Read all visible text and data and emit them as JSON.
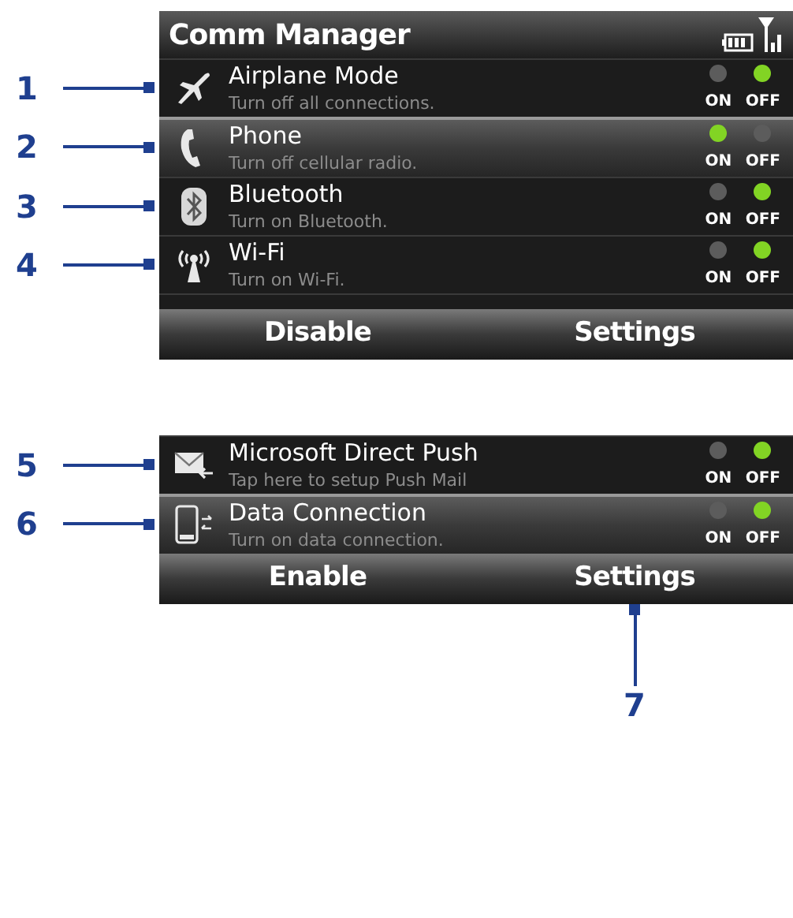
{
  "screens": [
    {
      "title": "Comm Manager",
      "rows": [
        {
          "callout": "1",
          "title": "Airplane Mode",
          "subtitle": "Turn off all connections.",
          "on": false,
          "selected": false,
          "on_label": "ON",
          "off_label": "OFF"
        },
        {
          "callout": "2",
          "title": "Phone",
          "subtitle": "Turn off cellular radio.",
          "on": true,
          "selected": true,
          "on_label": "ON",
          "off_label": "OFF"
        },
        {
          "callout": "3",
          "title": "Bluetooth",
          "subtitle": "Turn on Bluetooth.",
          "on": false,
          "selected": false,
          "on_label": "ON",
          "off_label": "OFF"
        },
        {
          "callout": "4",
          "title": "Wi-Fi",
          "subtitle": "Turn on Wi-Fi.",
          "on": false,
          "selected": false,
          "on_label": "ON",
          "off_label": "OFF"
        }
      ],
      "softkeys": [
        {
          "label": "Disable"
        },
        {
          "label": "Settings"
        }
      ]
    },
    {
      "rows": [
        {
          "callout": "5",
          "title": "Microsoft Direct Push",
          "subtitle": "Tap here to setup Push Mail",
          "on": false,
          "selected": false,
          "on_label": "ON",
          "off_label": "OFF"
        },
        {
          "callout": "6",
          "title": "Data Connection",
          "subtitle": "Turn on data connection.",
          "on": false,
          "selected": true,
          "on_label": "ON",
          "off_label": "OFF"
        }
      ],
      "softkeys": [
        {
          "label": "Enable"
        },
        {
          "label": "Settings",
          "callout": "7"
        }
      ]
    }
  ]
}
